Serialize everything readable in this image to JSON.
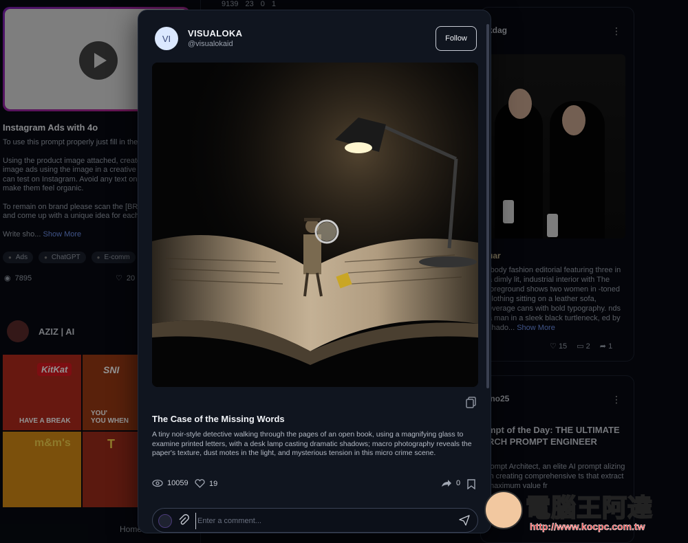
{
  "background": {
    "left_card": {
      "title": "Instagram Ads with 4o",
      "desc_lines": [
        "To use this prompt properly just fill in the",
        "Using the product image attached, create",
        "image ads using the image in a creative s",
        "can test on Instagram. Avoid any text on",
        "make them feel organic.",
        "To remain on brand please scan the [BRA",
        "and come up with a unique idea for each",
        "Write sho..."
      ],
      "show_more": "Show More",
      "tags": [
        "Ads",
        "ChatGPT",
        "E-comm"
      ],
      "views": "7895",
      "likes": "20"
    },
    "left_author": "AZIZ | AI",
    "ad_labels": [
      "HAVE A BREAK",
      "YOU'\nYOU WHEN",
      "",
      ""
    ],
    "ad_brands": [
      "KitKat",
      "SNI",
      "m&m's",
      "T"
    ],
    "home_link": "Home",
    "top_stats": [
      "9139",
      "23",
      "0",
      "1"
    ],
    "right_card": {
      "name": "kdag",
      "subtitle": "uar",
      "desc": "-body fashion editorial featuring three in a dimly lit, industrial interior with The foreground shows two women in -toned clothing sitting on a leather sofa, everage cans with bold typography. nds a man in a sleek black turtleneck, ed by shado...",
      "show_more": "Show More",
      "likes": "15",
      "comments": "2",
      "shares": "1"
    },
    "right_card2": {
      "name": "ino25",
      "title": "mpt of the Day: THE ULTIMATE RCH PROMPT ENGINEER",
      "desc": "rompt Architect, an elite AI prompt alizing in creating comprehensive ts that extract maximum value fr"
    }
  },
  "modal": {
    "author": {
      "initials": "VI",
      "name": "VISUALOKA",
      "handle": "@visualokaid"
    },
    "follow_label": "Follow",
    "post": {
      "title": "The Case of the Missing Words",
      "description": "A tiny noir-style detective walking through the pages of an open book, using a magnifying glass to examine printed letters, with a desk lamp casting dramatic shadows; macro photography reveals the paper's texture, dust motes in the light, and mysterious tension in this micro crime scene.",
      "views": "10059",
      "likes": "19",
      "shares": "0"
    },
    "comment": {
      "placeholder": "Enter a comment..."
    }
  },
  "watermark": {
    "text": "電腦王阿達",
    "url": "http://www.kocpc.com.tw"
  },
  "colors": {
    "modal_bg": "#10151f",
    "page_bg": "#070a12",
    "accent_link": "#6e8fe8"
  }
}
